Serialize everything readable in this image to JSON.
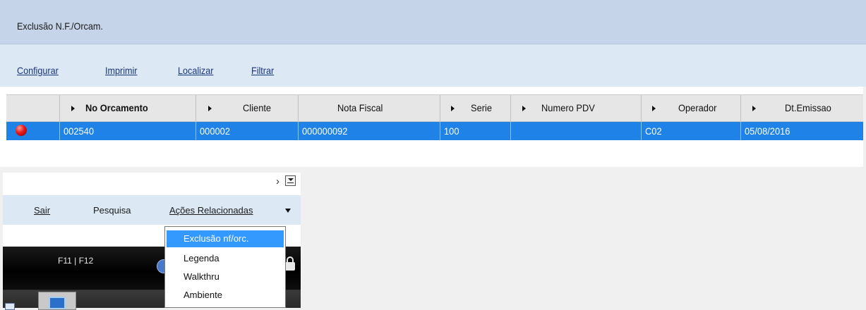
{
  "window": {
    "title": "Exclusão N.F./Orcam."
  },
  "toolbar": {
    "links": [
      "Configurar",
      "Imprimir",
      "Localizar",
      "Filtrar"
    ]
  },
  "grid": {
    "columns": [
      "No Orcamento",
      "Cliente",
      "Nota Fiscal",
      "Serie",
      "Numero PDV",
      "Operador",
      "Dt.Emissao"
    ],
    "rows": [
      {
        "status": "red",
        "no_orcamento": "002540",
        "cliente": "000002",
        "nota_fiscal": "000000092",
        "serie": "100",
        "numero_pdv": "",
        "operador": "C02",
        "dt_emissao": "05/08/2016"
      }
    ]
  },
  "panel": {
    "sair_label": "Sair",
    "pesquisa_label": "Pesquisa",
    "acoes_label": "Ações Relacionadas"
  },
  "taskbar": {
    "fkeys_label": "F11 | F12"
  },
  "dropdown": {
    "items": [
      "Exclusão nf/orc.",
      "Legenda",
      "Walkthru",
      "Ambiente"
    ],
    "selected": "Exclusão nf/orc."
  },
  "colors": {
    "title_bar": "#c5d4e9",
    "toolbar": "#dde8f5",
    "selected_row": "#1e82e6",
    "menu_highlight": "#3399ff",
    "status_red": "#e51818"
  }
}
